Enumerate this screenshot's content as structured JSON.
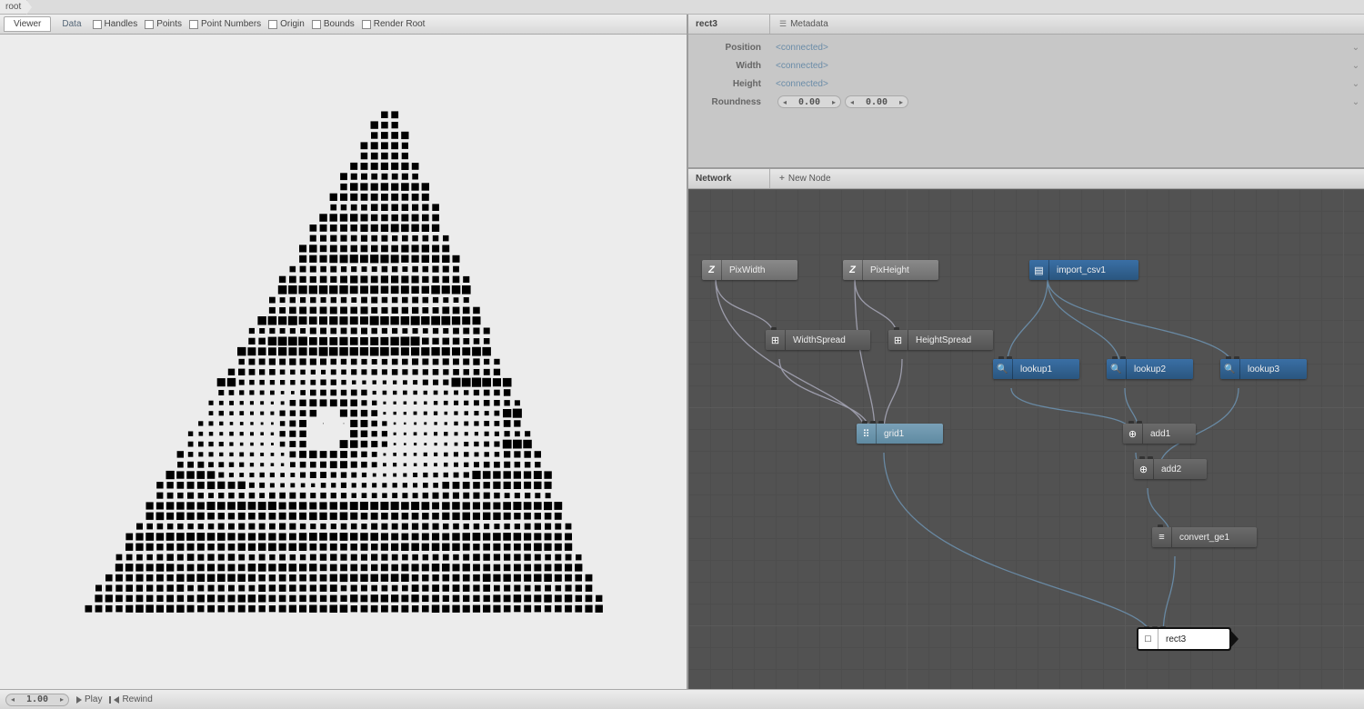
{
  "breadcrumb": {
    "root": "root"
  },
  "viewer": {
    "tabs": {
      "viewer": "Viewer",
      "data": "Data"
    },
    "checks": {
      "handles": "Handles",
      "points": "Points",
      "point_numbers": "Point Numbers",
      "origin": "Origin",
      "bounds": "Bounds",
      "render_root": "Render Root"
    }
  },
  "props": {
    "node_name": "rect3",
    "metadata_btn": "Metadata",
    "rows": {
      "position": {
        "label": "Position",
        "value": "<connected>"
      },
      "width": {
        "label": "Width",
        "value": "<connected>"
      },
      "height": {
        "label": "Height",
        "value": "<connected>"
      },
      "roundness": {
        "label": "Roundness",
        "v1": "0.00",
        "v2": "0.00"
      }
    }
  },
  "network": {
    "label": "Network",
    "new_node": "New Node",
    "nodes": {
      "pixwidth": "PixWidth",
      "pixheight": "PixHeight",
      "widthspread": "WidthSpread",
      "heightspread": "HeightSpread",
      "grid1": "grid1",
      "import_csv1": "import_csv1",
      "lookup1": "lookup1",
      "lookup2": "lookup2",
      "lookup3": "lookup3",
      "add1": "add1",
      "add2": "add2",
      "convert_ge1": "convert_ge1",
      "rect3": "rect3"
    }
  },
  "playbar": {
    "frame": "1.00",
    "play": "Play",
    "rewind": "Rewind"
  }
}
